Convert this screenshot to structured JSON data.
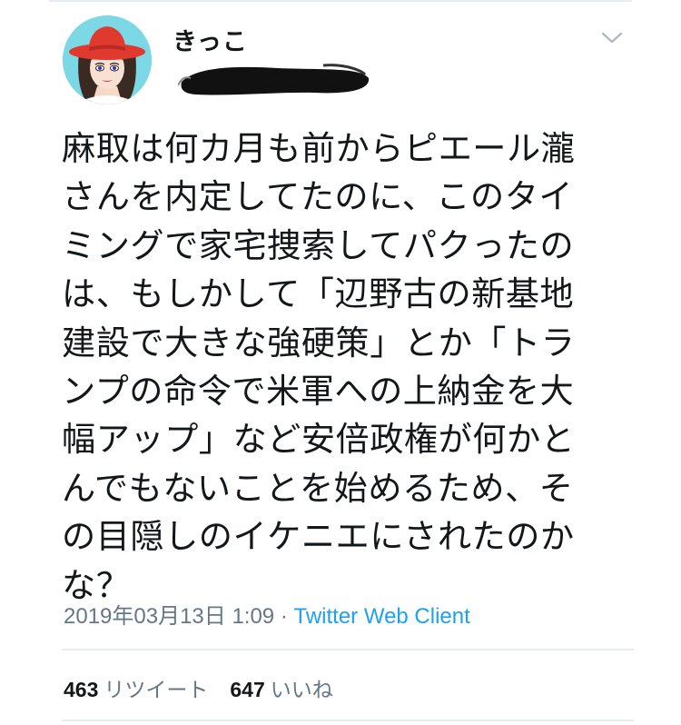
{
  "tweet": {
    "author": {
      "display_name": "きっこ",
      "avatar_icon": "avatar-illustration-red-hat"
    },
    "text": "麻取は何カ月も前からピエール瀧\nさんを内定してたのに、このタイ\nミングで家宅捜索してパクったの\nは、もしかして「辺野古の新基地\n建設で大きな強硬策」とか「トラ\nンプの命令で米軍への上納金を大\n幅アップ」など安倍政権が何かと\nんでもないことを始めるため、そ\nの目隠しのイケニエにされたのか\nな？",
    "timestamp": "2019年03月13日 1:09",
    "separator": " · ",
    "client": "Twitter Web Client",
    "retweet_count": "463",
    "retweet_label": "リツイート",
    "like_count": "647",
    "like_label": "いいね"
  },
  "colors": {
    "link": "#1da1f2",
    "muted": "#657786",
    "divider": "#e6ecf0",
    "avatar_bg": "#7dd8e6",
    "hat": "#e03a2e"
  }
}
